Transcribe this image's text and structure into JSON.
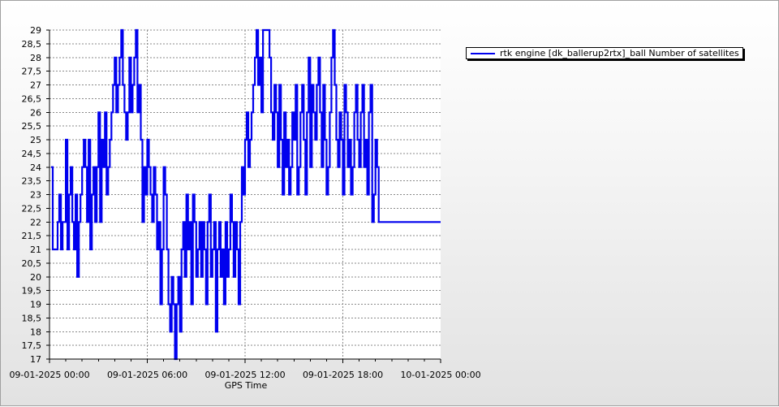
{
  "chart_data": {
    "type": "line",
    "title": "",
    "xlabel": "GPS Time",
    "ylabel": "",
    "ylim": [
      17,
      29
    ],
    "ytick_step": 0.5,
    "yticks": [
      "17",
      "17,5",
      "18",
      "18,5",
      "19",
      "19,5",
      "20",
      "20,5",
      "21",
      "21,5",
      "22",
      "22,5",
      "23",
      "23,5",
      "24",
      "24,5",
      "25",
      "25,5",
      "26",
      "26,5",
      "27",
      "27,5",
      "28",
      "28,5",
      "29"
    ],
    "xlim": [
      "09-01-2025 00:00",
      "10-01-2025 00:00"
    ],
    "xticks": [
      "09-01-2025 00:00",
      "09-01-2025 06:00",
      "09-01-2025 12:00",
      "09-01-2025 18:00",
      "10-01-2025 00:00"
    ],
    "grid": true,
    "legend_position": "top-right outside plot",
    "series": [
      {
        "name": "rtk engine [dk_ballerup2rtx]_ball Number of satellites",
        "color": "#0000ee",
        "x_hours": [
          0.1,
          0.2,
          0.3,
          0.4,
          0.5,
          0.6,
          0.7,
          0.8,
          0.9,
          1.0,
          1.1,
          1.2,
          1.3,
          1.4,
          1.5,
          1.6,
          1.7,
          1.8,
          1.9,
          2.0,
          2.1,
          2.2,
          2.3,
          2.4,
          2.5,
          2.6,
          2.7,
          2.8,
          2.9,
          3.0,
          3.1,
          3.2,
          3.3,
          3.4,
          3.5,
          3.6,
          3.7,
          3.8,
          3.9,
          4.0,
          4.1,
          4.2,
          4.3,
          4.4,
          4.5,
          4.6,
          4.7,
          4.8,
          4.9,
          5.0,
          5.1,
          5.2,
          5.3,
          5.4,
          5.5,
          5.6,
          5.7,
          5.8,
          5.9,
          6.0,
          6.1,
          6.2,
          6.3,
          6.4,
          6.5,
          6.6,
          6.7,
          6.8,
          6.9,
          7.0,
          7.1,
          7.2,
          7.3,
          7.4,
          7.5,
          7.6,
          7.7,
          7.8,
          7.9,
          8.0,
          8.1,
          8.2,
          8.3,
          8.4,
          8.5,
          8.6,
          8.7,
          8.8,
          8.9,
          9.0,
          9.1,
          9.2,
          9.3,
          9.4,
          9.5,
          9.6,
          9.7,
          9.8,
          9.9,
          10.0,
          10.1,
          10.2,
          10.3,
          10.4,
          10.5,
          10.6,
          10.7,
          10.8,
          10.9,
          11.0,
          11.1,
          11.2,
          11.3,
          11.4,
          11.5,
          11.6,
          11.7,
          11.8,
          11.9,
          12.0,
          12.1,
          12.2,
          12.3,
          12.4,
          12.5,
          12.6,
          12.7,
          12.8,
          12.9,
          13.0,
          13.1,
          13.2,
          13.3,
          13.4,
          13.5,
          13.6,
          13.7,
          13.8,
          13.9,
          14.0,
          14.1,
          14.2,
          14.3,
          14.4,
          14.5,
          14.6,
          14.7,
          14.8,
          14.9,
          15.0,
          15.1,
          15.2,
          15.3,
          15.4,
          15.5,
          15.6,
          15.7,
          15.8,
          15.9,
          16.0,
          16.1,
          16.2,
          16.3,
          16.4,
          16.5,
          16.6,
          16.7,
          16.8,
          16.9,
          17.0,
          17.1,
          17.2,
          17.3,
          17.4,
          17.5,
          17.6,
          17.7,
          17.8,
          17.9,
          18.0,
          18.1,
          18.2,
          18.3,
          18.4,
          18.5,
          18.6,
          18.7,
          18.8,
          18.9,
          19.0,
          19.1,
          19.2,
          19.3,
          19.4,
          19.5,
          19.6,
          19.7,
          19.8,
          19.9,
          20.0,
          20.1,
          20.2,
          20.3,
          20.4,
          20.5,
          20.6,
          20.7,
          20.8,
          20.9,
          21.0,
          21.1,
          21.2,
          21.3,
          21.4,
          21.5,
          21.6,
          21.7,
          21.8,
          21.9,
          22.0,
          22.1,
          22.2,
          22.3,
          22.4,
          22.5,
          22.6,
          22.7,
          22.8,
          22.9,
          23.0,
          23.1,
          23.2,
          23.3,
          23.4,
          23.5,
          23.6,
          23.7,
          23.8,
          23.9
        ],
        "values": [
          24,
          21,
          21,
          21,
          22,
          23,
          21,
          22,
          22,
          25,
          21,
          23,
          24,
          22,
          21,
          23,
          20,
          22,
          23,
          24,
          25,
          24,
          22,
          25,
          21,
          23,
          24,
          22,
          24,
          26,
          22,
          25,
          24,
          26,
          23,
          24,
          25,
          26,
          27,
          28,
          26,
          27,
          28,
          29,
          27,
          26,
          25,
          26,
          28,
          26,
          27,
          28,
          29,
          26,
          27,
          25,
          22,
          24,
          23,
          25,
          24,
          23,
          22,
          24,
          23,
          21,
          22,
          19,
          21,
          24,
          23,
          21,
          19,
          18,
          20,
          19,
          17,
          19,
          20,
          18,
          21,
          22,
          20,
          23,
          21,
          22,
          19,
          23,
          22,
          20,
          21,
          22,
          20,
          22,
          21,
          19,
          22,
          23,
          20,
          21,
          22,
          18,
          21,
          22,
          20,
          21,
          19,
          22,
          20,
          21,
          23,
          22,
          20,
          22,
          21,
          19,
          22,
          24,
          23,
          25,
          26,
          24,
          25,
          26,
          27,
          28,
          29,
          27,
          28,
          26,
          29,
          29,
          29,
          29,
          28,
          26,
          25,
          27,
          26,
          24,
          27,
          25,
          23,
          26,
          24,
          25,
          23,
          24,
          26,
          25,
          27,
          23,
          24,
          26,
          27,
          25,
          23,
          26,
          28,
          24,
          27,
          26,
          25,
          27,
          28,
          26,
          24,
          27,
          25,
          23,
          24,
          26,
          28,
          29,
          27,
          25,
          24,
          26,
          25,
          23,
          27,
          26,
          24,
          25,
          23,
          24,
          26,
          27,
          25,
          24,
          26,
          27,
          24,
          25,
          23,
          26,
          27,
          22,
          23,
          25,
          24,
          22
        ],
        "interpolation": "step"
      }
    ]
  }
}
